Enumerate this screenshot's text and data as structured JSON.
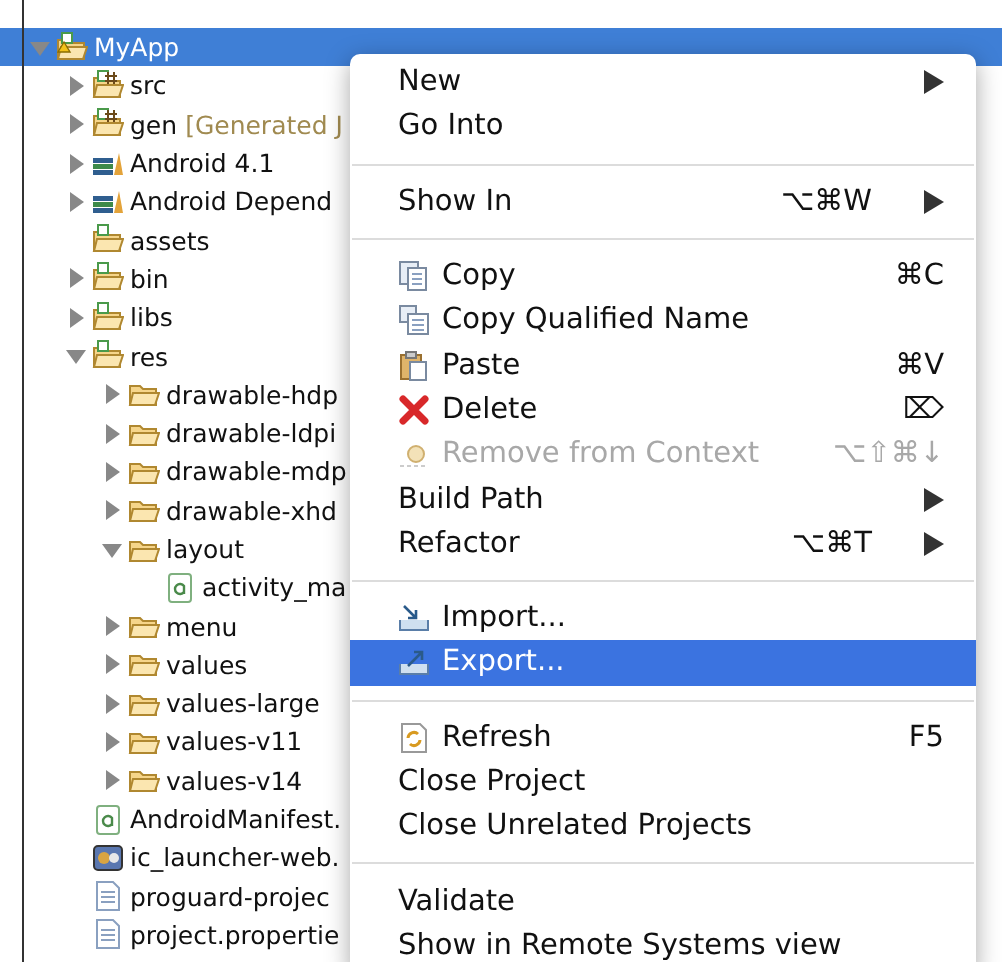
{
  "tree": {
    "items": [
      {
        "label": "MyApp",
        "kind": "project",
        "expanded": true,
        "selected": true,
        "children": [
          {
            "label": "src",
            "kind": "source",
            "expanded": false,
            "selected": false
          },
          {
            "label": "gen",
            "decoration": "[Generated J",
            "kind": "source",
            "expanded": false,
            "selected": false
          },
          {
            "label": "Android 4.1",
            "kind": "library",
            "expanded": false,
            "selected": false
          },
          {
            "label": "Android Depend",
            "kind": "library",
            "expanded": false,
            "selected": false
          },
          {
            "label": "assets",
            "kind": "source-folder",
            "selected": false
          },
          {
            "label": "bin",
            "kind": "source-folder",
            "expanded": false,
            "selected": false
          },
          {
            "label": "libs",
            "kind": "source-folder",
            "expanded": false,
            "selected": false
          },
          {
            "label": "res",
            "kind": "source-folder",
            "expanded": true,
            "selected": false,
            "children": [
              {
                "label": "drawable-hdp",
                "kind": "folder",
                "expanded": false,
                "selected": false
              },
              {
                "label": "drawable-ldpi",
                "kind": "folder",
                "expanded": false,
                "selected": false
              },
              {
                "label": "drawable-mdp",
                "kind": "folder",
                "expanded": false,
                "selected": false
              },
              {
                "label": "drawable-xhd",
                "kind": "folder",
                "expanded": false,
                "selected": false
              },
              {
                "label": "layout",
                "kind": "folder",
                "expanded": true,
                "selected": false,
                "children": [
                  {
                    "label": "activity_ma",
                    "kind": "xml",
                    "selected": false
                  }
                ]
              },
              {
                "label": "menu",
                "kind": "folder",
                "expanded": false,
                "selected": false
              },
              {
                "label": "values",
                "kind": "folder",
                "expanded": false,
                "selected": false
              },
              {
                "label": "values-large",
                "kind": "folder",
                "expanded": false,
                "selected": false
              },
              {
                "label": "values-v11",
                "kind": "folder",
                "expanded": false,
                "selected": false
              },
              {
                "label": "values-v14",
                "kind": "folder",
                "expanded": false,
                "selected": false
              }
            ]
          },
          {
            "label": "AndroidManifest.",
            "kind": "xml",
            "selected": false
          },
          {
            "label": "ic_launcher-web.",
            "kind": "image",
            "selected": false
          },
          {
            "label": "proguard-projec",
            "kind": "text",
            "selected": false
          },
          {
            "label": "project.propertie",
            "kind": "text",
            "selected": false
          }
        ]
      }
    ]
  },
  "context_menu": {
    "items": [
      {
        "kind": "item",
        "label": "New",
        "submenu": true,
        "disabled": false,
        "selected": false
      },
      {
        "kind": "item",
        "label": "Go Into",
        "submenu": false,
        "disabled": false,
        "selected": false
      },
      {
        "kind": "separator"
      },
      {
        "kind": "item",
        "label": "Show In",
        "shortcut": "⌥⌘W",
        "submenu": true,
        "disabled": false,
        "selected": false
      },
      {
        "kind": "separator"
      },
      {
        "kind": "item",
        "label": "Copy",
        "shortcut": "⌘C",
        "submenu": false,
        "disabled": false,
        "selected": false
      },
      {
        "kind": "item",
        "label": "Copy Qualified Name",
        "submenu": false,
        "disabled": false,
        "selected": false
      },
      {
        "kind": "item",
        "label": "Paste",
        "shortcut": "⌘V",
        "submenu": false,
        "disabled": false,
        "selected": false
      },
      {
        "kind": "item",
        "label": "Delete",
        "shortcut": "⌦",
        "submenu": false,
        "disabled": false,
        "selected": false
      },
      {
        "kind": "item",
        "label": "Remove from Context",
        "shortcut": "⌥⇧⌘↓",
        "submenu": false,
        "disabled": true,
        "selected": false
      },
      {
        "kind": "item",
        "label": "Build Path",
        "submenu": true,
        "disabled": false,
        "selected": false
      },
      {
        "kind": "item",
        "label": "Refactor",
        "shortcut": "⌥⌘T",
        "submenu": true,
        "disabled": false,
        "selected": false
      },
      {
        "kind": "separator"
      },
      {
        "kind": "item",
        "label": "Import...",
        "submenu": false,
        "disabled": false,
        "selected": false
      },
      {
        "kind": "item",
        "label": "Export...",
        "submenu": false,
        "disabled": false,
        "selected": true
      },
      {
        "kind": "separator"
      },
      {
        "kind": "item",
        "label": "Refresh",
        "shortcut": "F5",
        "submenu": false,
        "disabled": false,
        "selected": false
      },
      {
        "kind": "item",
        "label": "Close Project",
        "submenu": false,
        "disabled": false,
        "selected": false
      },
      {
        "kind": "item",
        "label": "Close Unrelated Projects",
        "submenu": false,
        "disabled": false,
        "selected": false
      },
      {
        "kind": "separator"
      },
      {
        "kind": "item",
        "label": "Validate",
        "submenu": false,
        "disabled": false,
        "selected": false
      },
      {
        "kind": "item",
        "label": "Show in Remote Systems view",
        "submenu": false,
        "disabled": false,
        "selected": false
      }
    ]
  }
}
